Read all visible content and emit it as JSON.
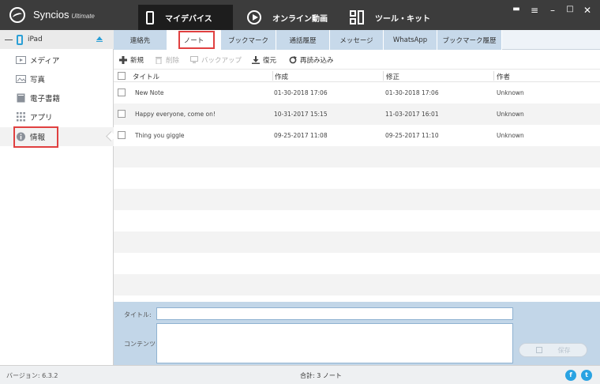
{
  "app": {
    "name": "Syncios",
    "edition": "Ultimate"
  },
  "nav": {
    "tabs": [
      {
        "label": "マイデバイス",
        "active": true
      },
      {
        "label": "オンライン動画",
        "active": false
      },
      {
        "label": "ツール・キット",
        "active": false
      }
    ]
  },
  "window_controls": [
    "message-icon",
    "menu-icon",
    "minimize-icon",
    "maximize-icon",
    "close-icon"
  ],
  "sidebar": {
    "device": {
      "name": "iPad"
    },
    "items": [
      {
        "label": "メディア",
        "icon": "media-icon"
      },
      {
        "label": "写真",
        "icon": "photo-icon"
      },
      {
        "label": "電子書籍",
        "icon": "book-icon"
      },
      {
        "label": "アプリ",
        "icon": "apps-icon"
      },
      {
        "label": "情報",
        "icon": "info-icon",
        "active": true
      }
    ]
  },
  "tabs": [
    {
      "label": "連絡先"
    },
    {
      "label": "ノート",
      "active": true
    },
    {
      "label": "ブックマーク"
    },
    {
      "label": "通話履歴"
    },
    {
      "label": "メッセージ"
    },
    {
      "label": "WhatsApp"
    },
    {
      "label": "ブックマーク履歴"
    }
  ],
  "toolbar": {
    "new": "新規",
    "delete": "削除",
    "backup": "バックアップ",
    "restore": "復元",
    "reload": "再読み込み"
  },
  "table": {
    "columns": [
      "タイトル",
      "作成",
      "修正",
      "作者"
    ],
    "rows": [
      {
        "title": "New Note",
        "created": "01-30-2018 17:06",
        "modified": "01-30-2018 17:06",
        "author": "Unknown"
      },
      {
        "title": "Happy everyone, come on!",
        "created": "10-31-2017 15:15",
        "modified": "11-03-2017 16:01",
        "author": "Unknown"
      },
      {
        "title": "Thing you giggle",
        "created": "09-25-2017 11:08",
        "modified": "09-25-2017 11:10",
        "author": "Unknown"
      }
    ]
  },
  "editor": {
    "title_label": "タイトル:",
    "content_label": "コンテンツ:",
    "title_value": "",
    "content_value": "",
    "save_label": "保存"
  },
  "status": {
    "version": "バージョン: 6.3.2",
    "total": "合計: 3 ノート"
  },
  "social": [
    "facebook-icon",
    "twitter-icon"
  ],
  "colors": {
    "titlebar": "#3c3c3c",
    "tab_bg": "#c7d9ea",
    "highlight": "#e04040",
    "accent": "#2a9fd6"
  }
}
